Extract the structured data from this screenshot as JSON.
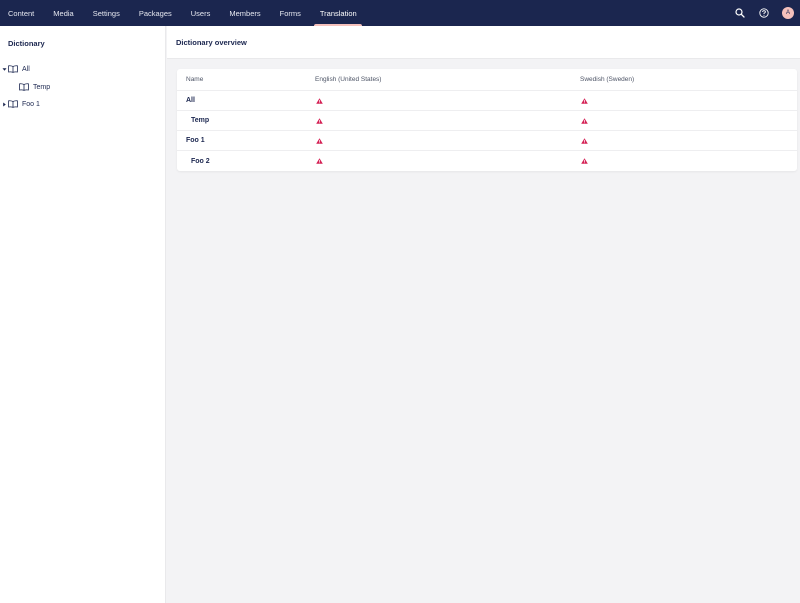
{
  "nav": {
    "items": [
      {
        "label": "Content",
        "active": false
      },
      {
        "label": "Media",
        "active": false
      },
      {
        "label": "Settings",
        "active": false
      },
      {
        "label": "Packages",
        "active": false
      },
      {
        "label": "Users",
        "active": false
      },
      {
        "label": "Members",
        "active": false
      },
      {
        "label": "Forms",
        "active": false
      },
      {
        "label": "Translation",
        "active": true
      }
    ],
    "icons": [
      "search-icon",
      "help-icon",
      "user-avatar"
    ],
    "avatar_initial": "A"
  },
  "colors": {
    "topbar": "#1b264f",
    "active_indicator": "#f5c1bc",
    "warning": "#d42054"
  },
  "sidebar": {
    "title": "Dictionary",
    "tree": [
      {
        "label": "All",
        "expanded": true,
        "level": 0,
        "icon": "book-icon"
      },
      {
        "label": "Temp",
        "expanded": null,
        "level": 1,
        "icon": "book-icon"
      },
      {
        "label": "Foo 1",
        "expanded": false,
        "level": 0,
        "icon": "book-icon"
      }
    ]
  },
  "main": {
    "title": "Dictionary overview",
    "table": {
      "columns": [
        "Name",
        "English (United States)",
        "Swedish (Sweden)"
      ],
      "rows": [
        {
          "name": "All",
          "en": "warning-icon",
          "sv": "warning-icon"
        },
        {
          "name": "Temp",
          "en": "warning-icon",
          "sv": "warning-icon"
        },
        {
          "name": "Foo 1",
          "en": "warning-icon",
          "sv": "warning-icon"
        },
        {
          "name": "Foo 2",
          "en": "warning-icon",
          "sv": "warning-icon"
        }
      ]
    }
  }
}
